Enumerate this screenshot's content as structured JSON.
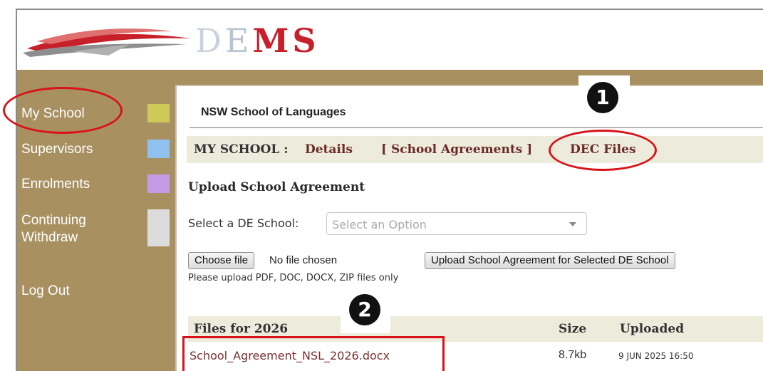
{
  "app": {
    "logo_text": "DEMS"
  },
  "sidebar": {
    "items": [
      {
        "label": "My School",
        "color": "#cfc95a"
      },
      {
        "label": "Supervisors",
        "color": "#8fc1f0"
      },
      {
        "label": "Enrolments",
        "color": "#c59be8"
      },
      {
        "label": "Continuing\nWithdraw",
        "color": "#dcdcdc"
      },
      {
        "label": "Log Out"
      }
    ]
  },
  "main": {
    "school_name": "NSW School of Languages",
    "tabbar": {
      "label": "MY SCHOOL :",
      "details": "Details",
      "agreements": "[ School Agreements ]",
      "dec_files": "DEC Files"
    },
    "section_title": "Upload School Agreement",
    "select_label": "Select a DE School:",
    "select_value": "Select an Option",
    "choose_file_label": "Choose file",
    "no_file_text": "No file chosen",
    "upload_button_label": "Upload School Agreement for Selected DE School",
    "hint": "Please upload PDF, DOC, DOCX, ZIP files only",
    "files_table": {
      "columns": [
        "Files for 2026",
        "Size",
        "Uploaded"
      ],
      "rows": [
        {
          "name": "School_Agreement_NSL_2026.docx",
          "size": "8.7kb",
          "uploaded": "9 JUN 2025 16:50"
        }
      ]
    }
  },
  "annotations": {
    "marker_1": "1",
    "marker_2": "2",
    "accent": "#d8141a"
  }
}
